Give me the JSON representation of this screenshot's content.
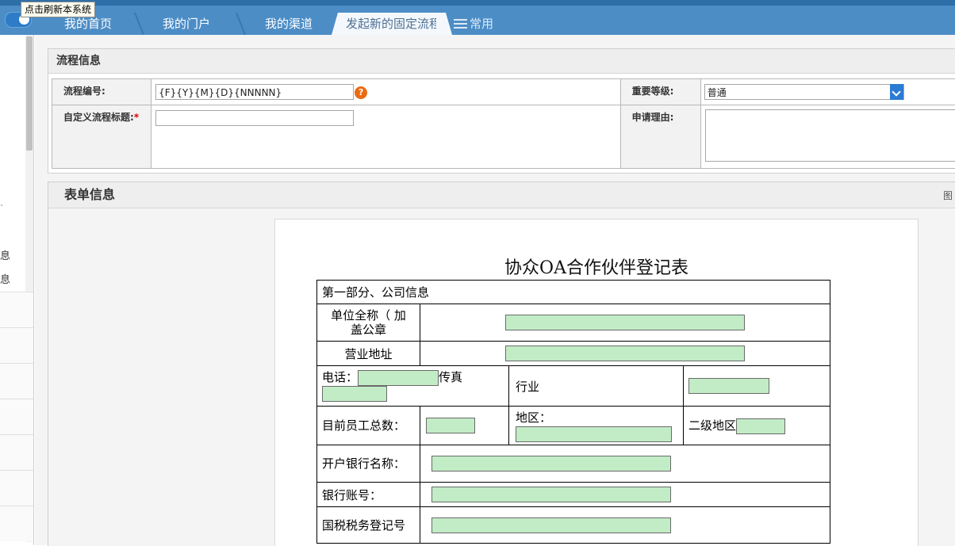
{
  "tooltip": "点击刷新本系统",
  "tabs": {
    "home": "我的首页",
    "portal": "我的门户",
    "channel": "我的渠道",
    "new_flow": "发起新的固定流程",
    "common": "常用"
  },
  "sidebar": {
    "items": [
      "息",
      "息"
    ]
  },
  "process": {
    "section_title": "流程信息",
    "number_label": "流程编号:",
    "number_value": "{F}{Y}{M}{D}{NNNNN}",
    "help_glyph": "?",
    "title_label": "自定义流程标题:",
    "required_mark": "*",
    "title_value": "",
    "importance_label": "重要等级:",
    "importance_value": "普通",
    "reason_label": "申请理由:",
    "reason_value": ""
  },
  "form_section": {
    "title": "表单信息",
    "right_edge_glyph": "图"
  },
  "document": {
    "title": "协众OA合作伙伴登记表",
    "section1": "第一部分、公司信息",
    "company_name": "单位全称（ 加盖公章",
    "business_address": "营业地址",
    "phone": "电话：",
    "fax": "传真",
    "industry": "行业",
    "employees": "目前员工总数：",
    "region": "地区：",
    "sub_region": "二级地区",
    "bank_name": "开户银行名称：",
    "bank_account": "银行账号：",
    "tax_number": "国税税务登记号"
  },
  "colors": {
    "topbar": "#4c8dc6",
    "field_green": "#c2ecc6",
    "help_orange": "#ea6a12",
    "select_blue": "#2b7bd2"
  }
}
